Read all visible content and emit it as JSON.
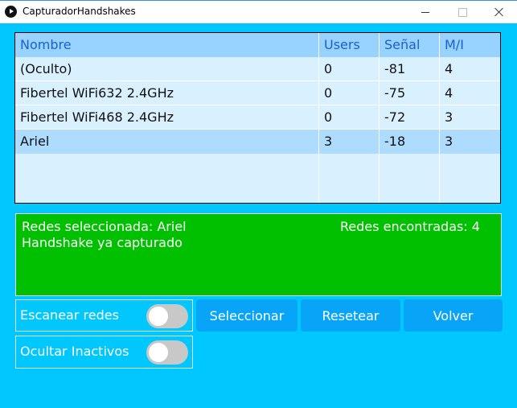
{
  "window": {
    "title": "CapturadorHandshakes"
  },
  "table": {
    "columns": [
      "Nombre",
      "Users",
      "Señal",
      "M/I"
    ],
    "rows": [
      [
        "(Oculto)",
        "0",
        "-81",
        "4"
      ],
      [
        "Fibertel WiFi632 2.4GHz",
        "0",
        "-75",
        "4"
      ],
      [
        "Fibertel WiFi468 2.4GHz",
        "0",
        "-72",
        "3"
      ],
      [
        "Ariel",
        "3",
        "-18",
        "3"
      ]
    ],
    "selected_row": "Ariel"
  },
  "info": {
    "selected": "Redes seleccionada: Ariel",
    "found": "Redes encontradas: 4",
    "status": "Handshake ya capturado"
  },
  "toggles": {
    "scan_label": "Escanear redes",
    "scan_on": false,
    "hide_label": "Ocultar Inactivos",
    "hide_on": false
  },
  "buttons": {
    "select_label": "Seleccionar",
    "reset_label": "Resetear",
    "back_label": "Volver"
  },
  "colors": {
    "background": "#00c8ff",
    "table_header": "#98d3ff",
    "table_body": "#d9f0ff",
    "selected_row": "#aedcff",
    "header_text": "#1c5fcc",
    "info_panel": "#00c000",
    "button": "#08a4f8",
    "switch_off": "#c8c8c8"
  },
  "icons": {
    "app": "play-circle-icon",
    "minimize": "minimize-icon",
    "maximize": "maximize-icon",
    "close": "close-icon"
  }
}
